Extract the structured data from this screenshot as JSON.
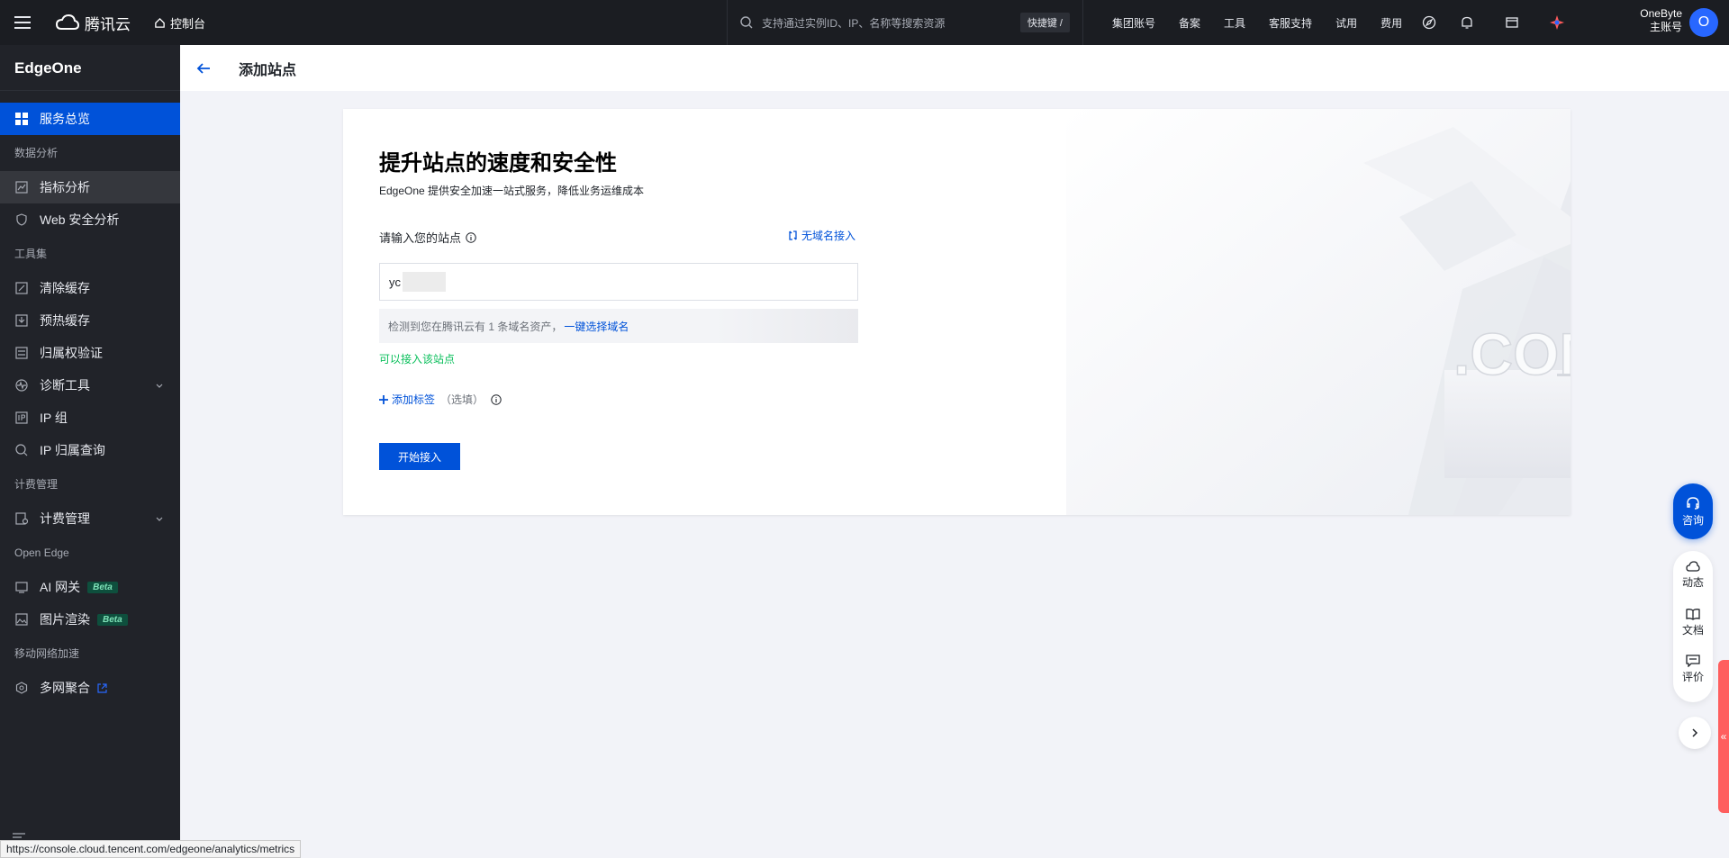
{
  "topbar": {
    "brand": "腾讯云",
    "console": "控制台",
    "search_placeholder": "支持通过实例ID、IP、名称等搜索资源",
    "shortcut": "快捷键 /",
    "nav": [
      "集团账号",
      "备案",
      "工具",
      "客服支持",
      "试用",
      "费用"
    ],
    "account_name": "OneByte",
    "account_role": "主账号",
    "avatar_letter": "O"
  },
  "sidebar": {
    "title": "EdgeOne",
    "overview": "服务总览",
    "group_analysis": "数据分析",
    "metrics": "指标分析",
    "web_security": "Web 安全分析",
    "group_tools": "工具集",
    "purge": "清除缓存",
    "prefetch": "预热缓存",
    "ownership": "归属权验证",
    "diagnose": "诊断工具",
    "ip_group": "IP 组",
    "ip_lookup": "IP 归属查询",
    "group_billing": "计费管理",
    "billing": "计费管理",
    "group_open_edge": "Open Edge",
    "ai_gateway": "AI 网关",
    "image_render": "图片渲染",
    "beta": "Beta",
    "group_mobile": "移动网络加速",
    "multi_net": "多网聚合"
  },
  "page": {
    "title": "添加站点"
  },
  "card": {
    "hero": "提升站点的速度和安全性",
    "subtitle": "EdgeOne 提供安全加速一站式服务，降低业务运维成本",
    "field_label": "请输入您的站点",
    "no_domain": "无域名接入",
    "input_value": "yc",
    "hint_text": "检测到您在腾讯云有 1 条域名资产，",
    "hint_link": "一键选择域名",
    "ok_text": "可以接入该站点",
    "add_tag": "添加标签",
    "optional": "（选填）",
    "start_button": "开始接入"
  },
  "floating": {
    "consult": "咨询",
    "news": "动态",
    "docs": "文档",
    "review": "评价"
  },
  "status_url": "https://console.cloud.tencent.com/edgeone/analytics/metrics",
  "colors": {
    "primary": "#0052d9",
    "success": "#0abf5b",
    "topbar": "#1b1d22",
    "sidebar": "#212329"
  }
}
